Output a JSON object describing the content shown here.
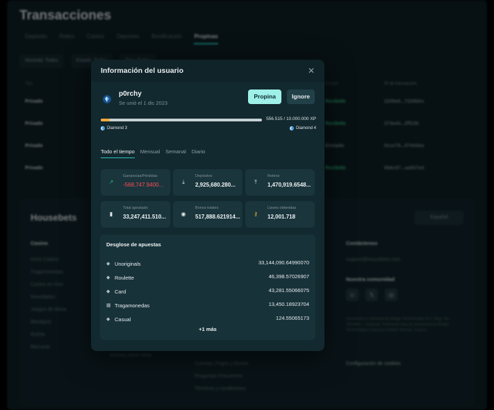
{
  "background": {
    "title": "Transacciones",
    "tabs": [
      "Depósito",
      "Retiro",
      "Casino",
      "Deportes",
      "Bonificación",
      "Propinas"
    ],
    "active_tab": "Propinas",
    "filters": [
      "Moneda: Todos",
      "Estado: Todos",
      "Tipo: Todos"
    ],
    "table": {
      "headers": [
        "Tipo",
        "Estado",
        "ID de transacción"
      ],
      "rows": [
        [
          "Privado",
          "Recibido",
          "2209a0...7229bbs"
        ],
        [
          "Privado",
          "Recibido",
          "274a44...2ff23b"
        ],
        [
          "Privado",
          "Enviado",
          "0cce78...074ebba"
        ],
        [
          "Privado",
          "Recibido",
          "8b6c87...aa0b7a4"
        ]
      ]
    },
    "footer": {
      "logo": "Housebets",
      "language": "Español",
      "casino_heading": "Casino",
      "casino_links": [
        "Inicio Casino",
        "Tragamonedas",
        "Casino en Vivo",
        "Novedades",
        "Juegos de Mesa",
        "Blackjack",
        "Ruleta",
        "Baccarat"
      ],
      "sports_links": [
        "Hockey sobre Hielo"
      ],
      "support_links": [
        "Cuentas, Pagos y Bonos",
        "Preguntas Frecuentes",
        "Términos y condiciones"
      ],
      "contact_heading": "Contáctenos",
      "contact_email": "support@housebets.com",
      "community_heading": "Nuestra comunidad",
      "fine_print": "Housebets is operated by Bridge Technologies B.V. (Reg. No. 161084) — Curaçao. Payments may be processed by Bridge Technologies (Cyprus) Limited, Nicosia, Cyprus.",
      "cookie_link": "Configuración de cookies"
    }
  },
  "modal": {
    "title": "Información del usuario",
    "username": "p0rchy",
    "joined": "Se unió el 1 dic 2023",
    "tip_label": "Propina",
    "ignore_label": "Ignore",
    "xp_text": "556.515 / 10.000.000 XP",
    "xp_progress": 0.056,
    "current_level": "Diamond 3",
    "next_level": "Diamond 4",
    "tabs": [
      "Todo el tiempo",
      "Mensual",
      "Semanal",
      "Diario"
    ],
    "active_tab": "Todo el tiempo",
    "stats": [
      {
        "label": "Ganancias/Pérdidas",
        "value": "-568,747.9400...",
        "icon": "trend-icon",
        "negative": true
      },
      {
        "label": "Depósitos",
        "value": "2,925,680.280...",
        "icon": "download-icon"
      },
      {
        "label": "Retiros",
        "value": "1,470,919.6548...",
        "icon": "upload-icon"
      },
      {
        "label": "Total apostado",
        "value": "33,247,411.510...",
        "icon": "bar-chart-icon"
      },
      {
        "label": "Bonos totales",
        "value": "517,888.621914...",
        "icon": "bonus-icon"
      },
      {
        "label": "Llaves obtenidas",
        "value": "12,001.718",
        "icon": "key-icon"
      }
    ],
    "breakdown": {
      "title": "Desglose de apuestas",
      "rows": [
        {
          "name": "Unoriginals",
          "value": "33,144,090.64990070",
          "icon": "diamond-icon"
        },
        {
          "name": "Roulette",
          "value": "46,398.57026907",
          "icon": "diamond-icon"
        },
        {
          "name": "Card",
          "value": "43,281.55066075",
          "icon": "diamond-icon"
        },
        {
          "name": "Tragamonedas",
          "value": "13,450.18923704",
          "icon": "slot-icon"
        },
        {
          "name": "Casual",
          "value": "124.55065173",
          "icon": "diamond-icon"
        }
      ],
      "more": "+1 más"
    }
  },
  "colors": {
    "accent": "#2bc4c0",
    "tip_button": "#9ff0e8",
    "negative": "#ff4d5a",
    "xp_fill": "#f2a93b"
  }
}
